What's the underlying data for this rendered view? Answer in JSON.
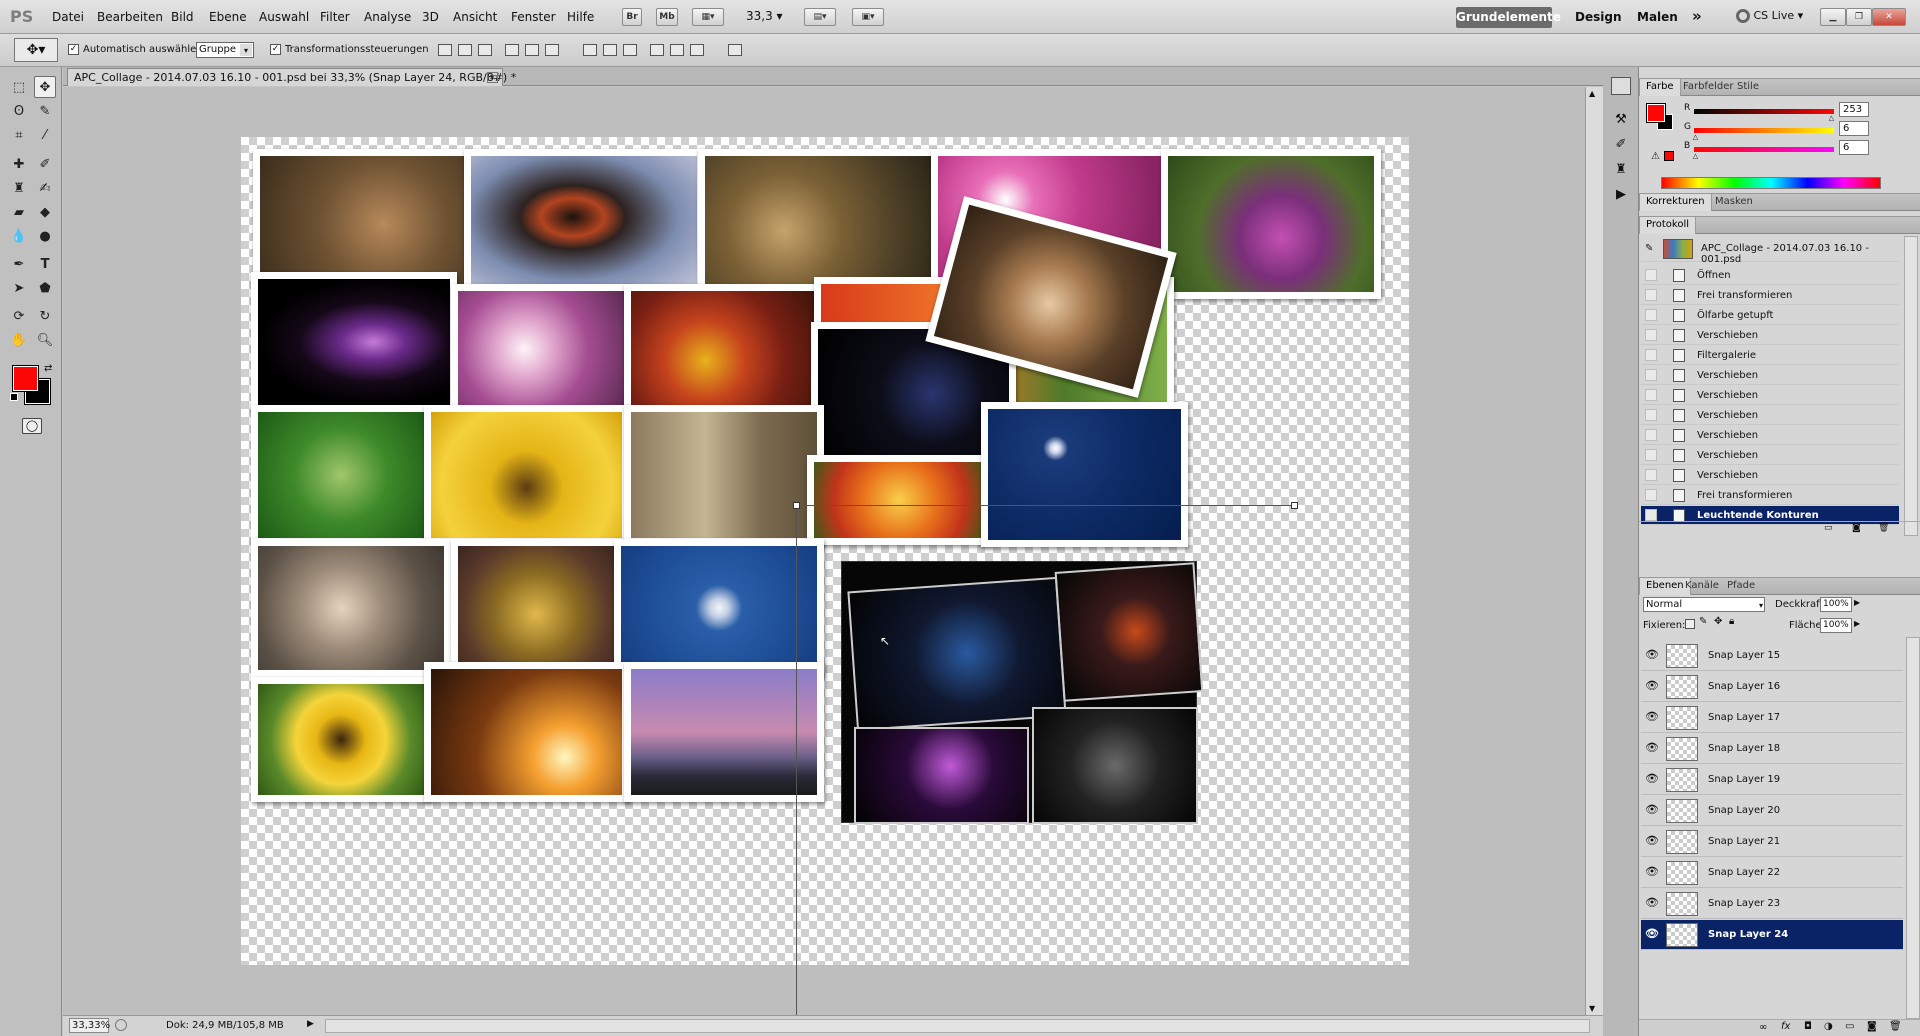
{
  "app": {
    "logo": "PS"
  },
  "menu": [
    "Datei",
    "Bearbeiten",
    "Bild",
    "Ebene",
    "Auswahl",
    "Filter",
    "Analyse",
    "3D",
    "Ansicht",
    "Fenster",
    "Hilfe"
  ],
  "appbar": {
    "bridge": "Br",
    "minibridge": "Mb",
    "zoom": "33,3"
  },
  "workspace": {
    "active": "Grundelemente",
    "items": [
      "Design",
      "Malen"
    ],
    "more": "»",
    "cslive": "CS Live"
  },
  "options": {
    "auto_select_label": "Automatisch auswählen:",
    "auto_select_value": "Gruppe",
    "transform_label": "Transformationssteuerungen"
  },
  "document": {
    "tab_title": "APC_Collage - 2014.07.03 16.10 - 001.psd bei 33,3% (Snap Layer 24, RGB/8#) *"
  },
  "status": {
    "zoom": "33,33%",
    "doc": "Dok: 24,9 MB/105,8 MB"
  },
  "color_panel": {
    "tabs": [
      "Farbe",
      "Farbfelder",
      "Stile"
    ],
    "foreground": "#fd0606",
    "channels": [
      {
        "label": "R",
        "value": "253",
        "fill": 0.99
      },
      {
        "label": "G",
        "value": "6",
        "fill": 0.02
      },
      {
        "label": "B",
        "value": "6",
        "fill": 0.02
      }
    ]
  },
  "adjust_panel": {
    "tabs": [
      "Korrekturen",
      "Masken"
    ]
  },
  "history": {
    "tab": "Protokoll",
    "snapshot": "APC_Collage - 2014.07.03 16.10 - 001.psd",
    "items": [
      "Öffnen",
      "Frei transformieren",
      "Ölfarbe getupft",
      "Verschieben",
      "Filtergalerie",
      "Verschieben",
      "Verschieben",
      "Verschieben",
      "Verschieben",
      "Verschieben",
      "Verschieben",
      "Frei transformieren",
      "Leuchtende Konturen"
    ]
  },
  "layers_panel": {
    "tabs": [
      "Ebenen",
      "Kanäle",
      "Pfade"
    ],
    "blend_mode": "Normal",
    "opacity_label": "Deckkraft:",
    "opacity": "100%",
    "lock_label": "Fixieren:",
    "fill_label": "Fläche:",
    "fill": "100%",
    "layers": [
      "Snap Layer 15",
      "Snap Layer 16",
      "Snap Layer 17",
      "Snap Layer 18",
      "Snap Layer 19",
      "Snap Layer 20",
      "Snap Layer 21",
      "Snap Layer 22",
      "Snap Layer 23",
      "Snap Layer 24"
    ],
    "selected": "Snap Layer 24"
  },
  "toolbox": {
    "foreground": "#fd0606",
    "background": "#000000"
  }
}
